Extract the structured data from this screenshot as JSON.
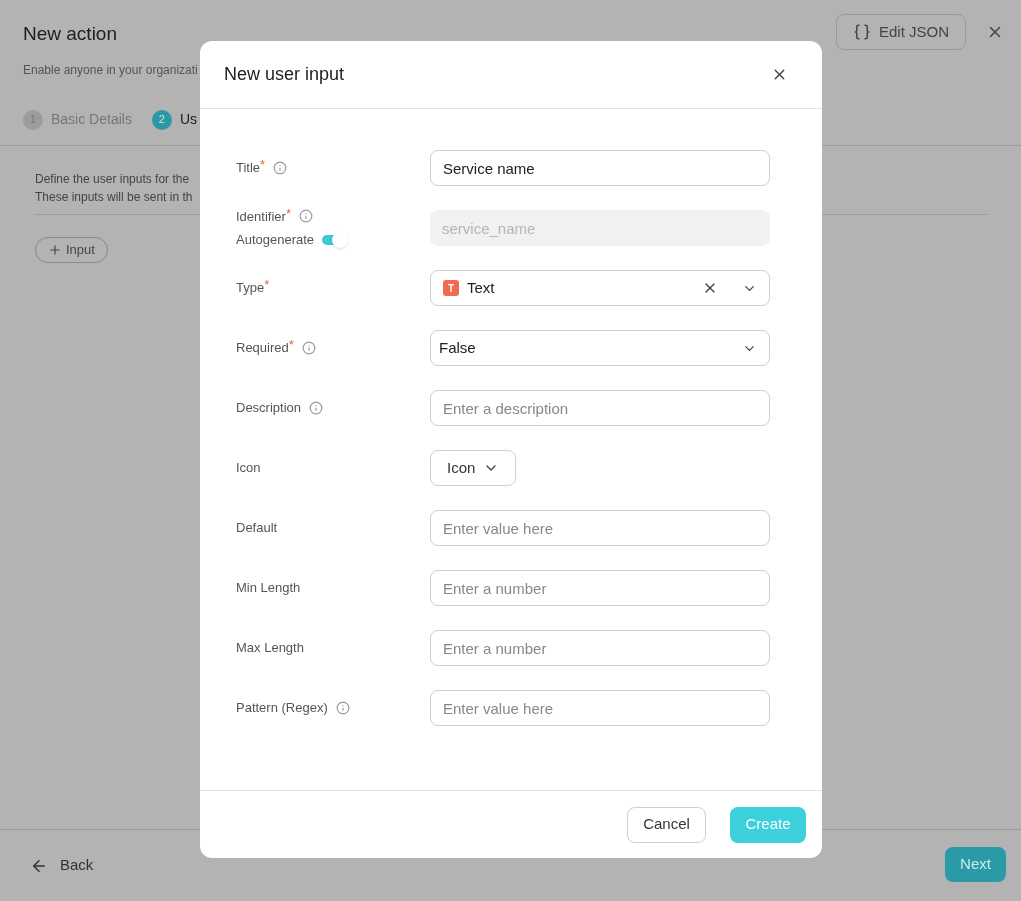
{
  "page": {
    "title": "New action",
    "subtitle": "Enable anyone in your organizati",
    "edit_json": "Edit JSON",
    "steps": [
      {
        "number": "1",
        "label": "Basic Details",
        "selected": false
      },
      {
        "number": "2",
        "label": "Us",
        "selected": true
      }
    ],
    "intro": [
      "Define the user inputs for the",
      "These inputs will be sent in th"
    ],
    "add_input": "Input",
    "back": "Back",
    "next": "Next"
  },
  "dialog": {
    "title": "New user input",
    "rows": [
      {
        "kind": "input",
        "label": "Title",
        "required_mark": "*",
        "info": true,
        "value": "Service name"
      },
      {
        "kind": "identifier",
        "label": "Identifier",
        "required_mark": "*",
        "info": true,
        "toggle_label": "Autogenerate",
        "on": true,
        "value": "service_name"
      },
      {
        "kind": "select",
        "label": "Type",
        "required_mark": "*",
        "info": false,
        "badge": "T",
        "value": "Text",
        "clearable": true
      },
      {
        "kind": "select",
        "label": "Required",
        "required_mark": "*",
        "info": true,
        "value": "False",
        "clearable": false
      },
      {
        "kind": "input",
        "label": "Description",
        "info": true,
        "placeholder": "Enter a description"
      },
      {
        "kind": "small-select",
        "label": "Icon",
        "info": false,
        "value": "Icon"
      },
      {
        "kind": "input",
        "label": "Default",
        "info": false,
        "placeholder": "Enter value here"
      },
      {
        "kind": "input",
        "label": "Min Length",
        "info": false,
        "placeholder": "Enter a number"
      },
      {
        "kind": "input",
        "label": "Max Length",
        "info": false,
        "placeholder": "Enter a number"
      },
      {
        "kind": "input",
        "label": "Pattern (Regex)",
        "info": true,
        "placeholder": "Enter value here"
      }
    ],
    "cancel": "Cancel",
    "create": "Create"
  }
}
